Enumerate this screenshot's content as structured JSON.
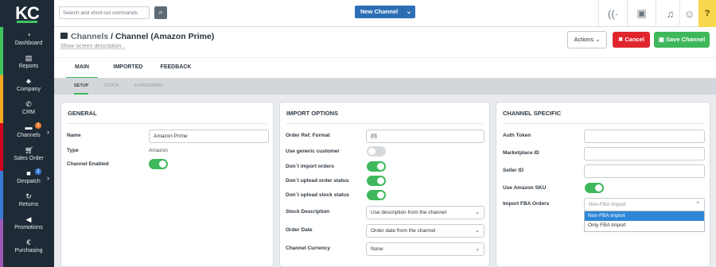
{
  "logo": "KC",
  "sidebar": {
    "items": [
      {
        "label": "Dashboard",
        "icon": "dashboard-icon"
      },
      {
        "label": "Reports",
        "icon": "reports-icon"
      },
      {
        "label": "Company",
        "icon": "company-icon"
      },
      {
        "label": "CRM",
        "icon": "phone-icon"
      },
      {
        "label": "Channels",
        "icon": "channels-icon",
        "badge": "1",
        "badge_color": "#f07a2e"
      },
      {
        "label": "Sales Order",
        "icon": "cart-icon"
      },
      {
        "label": "Despatch",
        "icon": "truck-icon",
        "badge": "1",
        "badge_color": "#3a7bd5"
      },
      {
        "label": "Returns",
        "icon": "returns-icon"
      },
      {
        "label": "Promotions",
        "icon": "megaphone-icon"
      },
      {
        "label": "Purchasing",
        "icon": "purchasing-icon"
      }
    ]
  },
  "topbar": {
    "search_placeholder": "Search and short-cut commands",
    "new_channel_label": "New Channel",
    "help_label": "?"
  },
  "header": {
    "crumb": "Channels",
    "separator": " / ",
    "title": "Channel (Amazon Prime)",
    "subdesc": "Show screen description...",
    "actions_label": "Actions",
    "cancel_label": "Cancel",
    "save_label": "Save Channel"
  },
  "tabs": [
    "MAIN",
    "IMPORTED ORDERS",
    "FEEDBACK"
  ],
  "subtabs": [
    "SETUP",
    "STOCK",
    "CATEGORIES"
  ],
  "general": {
    "title": "GENERAL",
    "name_label": "Name",
    "name_value": "Amazon Prime",
    "type_label": "Type",
    "type_value": "Amazon",
    "enabled_label": "Channel Enabled"
  },
  "import_options": {
    "title": "IMPORT OPTIONS",
    "order_ref_label": "Order Ref. Format",
    "order_ref_value": "{0}",
    "generic_customer_label": "Use generic customer",
    "dont_import_label": "Don`t import orders",
    "dont_upload_status_label": "Don`t upload order status",
    "dont_upload_stock_label": "Don`t upload stock status",
    "stock_desc_label": "Stock Description",
    "stock_desc_value": "Use description from the channel",
    "order_date_label": "Order Date",
    "order_date_value": "Order date from the channel",
    "currency_label": "Channel Currency",
    "currency_value": "None"
  },
  "channel_specific": {
    "title": "CHANNEL SPECIFIC",
    "auth_token_label": "Auth Token",
    "marketplace_label": "Marketplace ID",
    "seller_label": "Seller ID",
    "use_sku_label": "Use Amazon SKU",
    "fba_label": "Import FBA Orders",
    "fba_value": "Non-FBA Import",
    "fba_options": [
      "Non-FBA Import",
      "Only FBA Import"
    ]
  }
}
